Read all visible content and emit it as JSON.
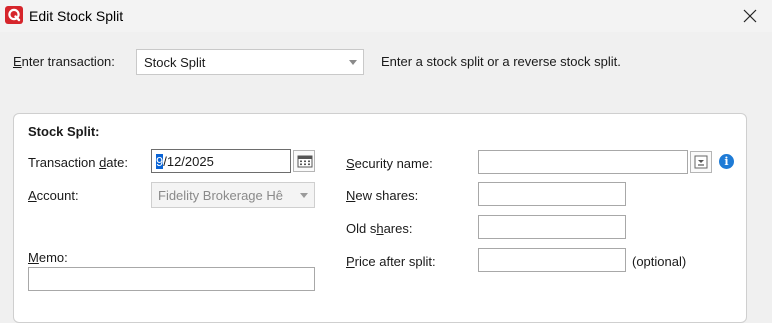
{
  "window": {
    "title": "Edit Stock Split",
    "icon": "app-logo-icon",
    "close_icon": "close-icon"
  },
  "header": {
    "enter_transaction_label": "Enter transaction:",
    "transaction_type": "Stock Split",
    "description": "Enter a stock split or a reverse stock split."
  },
  "form": {
    "section_title": "Stock Split:",
    "transaction_date_label": "Transaction date:",
    "transaction_date_selected": "9",
    "transaction_date_rest": "/12/2025",
    "account_label": "Account:",
    "account_value": "Fidelity Brokerage Hê",
    "memo_label": "Memo:",
    "memo_value": "",
    "security_name_label": "Security name:",
    "security_name_value": "",
    "new_shares_label": "New shares:",
    "new_shares_value": "",
    "old_shares_label": "Old shares:",
    "old_shares_value": "",
    "price_after_split_label": "Price after split:",
    "price_after_split_value": "",
    "optional_note": "(optional)"
  },
  "colors": {
    "accent": "#0a64d6",
    "brand": "#d6252b",
    "info": "#1e7bd6"
  }
}
